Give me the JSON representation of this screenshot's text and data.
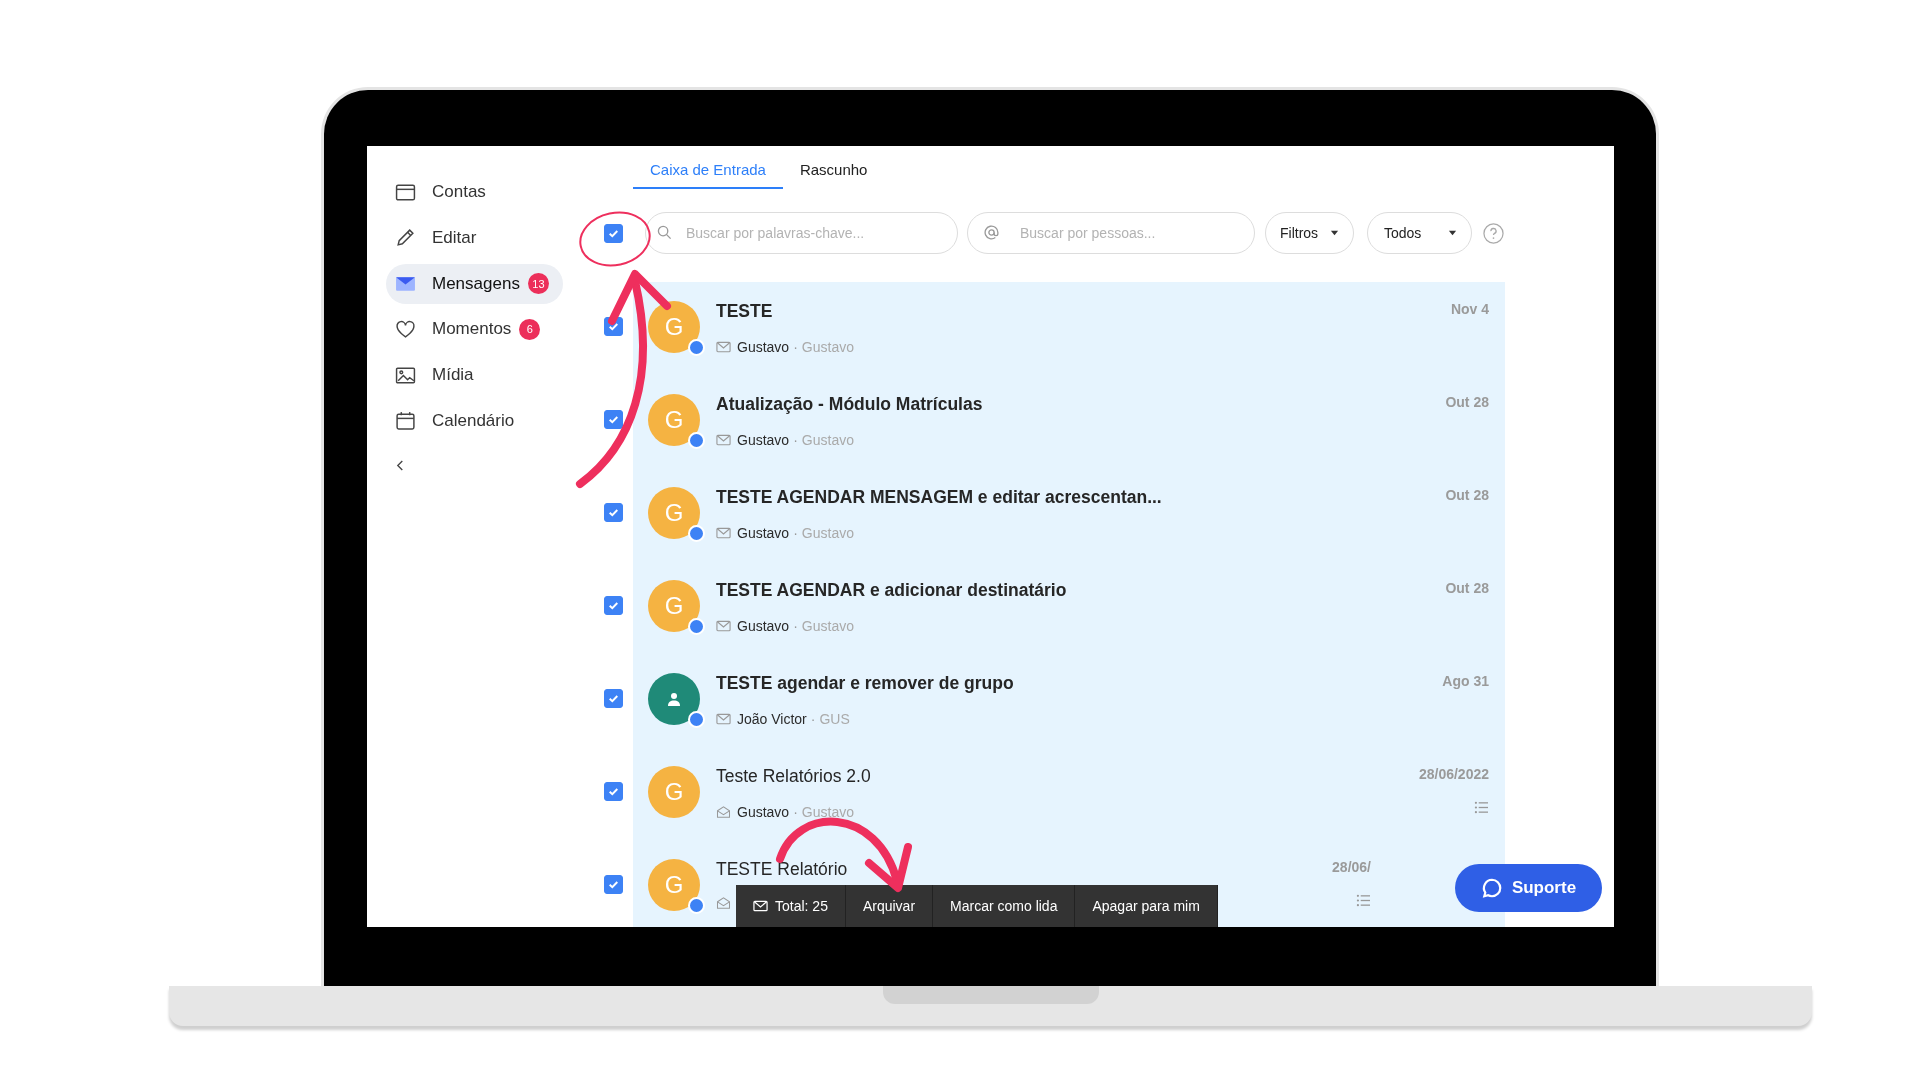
{
  "sidebar": {
    "items": [
      {
        "label": "Contas",
        "selected": false
      },
      {
        "label": "Editar",
        "selected": false
      },
      {
        "label": "Mensagens",
        "selected": true,
        "badge": "13"
      },
      {
        "label": "Momentos",
        "selected": false,
        "badge": "6"
      },
      {
        "label": "Mídia",
        "selected": false
      },
      {
        "label": "Calendário",
        "selected": false
      }
    ]
  },
  "tabs": [
    {
      "label": "Caixa de Entrada",
      "selected": true
    },
    {
      "label": "Rascunho",
      "selected": false
    }
  ],
  "toolbar": {
    "select_all_checked": true,
    "keyword_search": {
      "placeholder": "Buscar por palavras-chave..."
    },
    "people_search": {
      "placeholder": "Buscar por pessoas..."
    },
    "dropdowns": [
      "Filtros",
      "Todos"
    ]
  },
  "messages": [
    {
      "checked": true,
      "avatar": {
        "kind": "letter",
        "letter": "G",
        "color": "#f5b342"
      },
      "online": true,
      "title": "TESTE",
      "sender": "Gustavo",
      "separator": "·",
      "recipient": "Gustavo",
      "date": "Nov 4",
      "read": false,
      "report": false
    },
    {
      "checked": true,
      "avatar": {
        "kind": "letter",
        "letter": "G",
        "color": "#f5b342"
      },
      "online": true,
      "title": "Atualização - Módulo Matrículas",
      "sender": "Gustavo",
      "separator": "·",
      "recipient": "Gustavo",
      "date": "Out 28",
      "read": false,
      "report": false
    },
    {
      "checked": true,
      "avatar": {
        "kind": "letter",
        "letter": "G",
        "color": "#f5b342"
      },
      "online": true,
      "title": "TESTE AGENDAR MENSAGEM e editar acrescentan...",
      "sender": "Gustavo",
      "separator": "·",
      "recipient": "Gustavo",
      "date": "Out 28",
      "read": false,
      "report": false
    },
    {
      "checked": true,
      "avatar": {
        "kind": "letter",
        "letter": "G",
        "color": "#f5b342"
      },
      "online": true,
      "title": "TESTE AGENDAR e adicionar destinatário",
      "sender": "Gustavo",
      "separator": "·",
      "recipient": "Gustavo",
      "date": "Out 28",
      "read": false,
      "report": false
    },
    {
      "checked": true,
      "avatar": {
        "kind": "group",
        "color": "#1f8a78"
      },
      "online": true,
      "title": "TESTE agendar e remover de grupo",
      "sender": "João Victor",
      "separator": "·",
      "recipient": "GUS",
      "date": "Ago 31",
      "read": false,
      "report": false
    },
    {
      "checked": true,
      "avatar": {
        "kind": "letter",
        "letter": "G",
        "color": "#f5b342"
      },
      "online": false,
      "title": "Teste Relatórios 2.0",
      "sender": "Gustavo",
      "separator": "·",
      "recipient": "Gustavo",
      "date": "28/06/2022",
      "read": true,
      "report": true
    },
    {
      "checked": true,
      "avatar": {
        "kind": "letter",
        "letter": "G",
        "color": "#f5b342"
      },
      "online": true,
      "title": "TESTE Relatório",
      "date": "28/06/",
      "read": true,
      "report": true
    }
  ],
  "bottom_bar": {
    "total": "Total: 25",
    "actions": [
      "Arquivar",
      "Marcar como lida",
      "Apagar para mim"
    ]
  },
  "support_button": "Suporte"
}
